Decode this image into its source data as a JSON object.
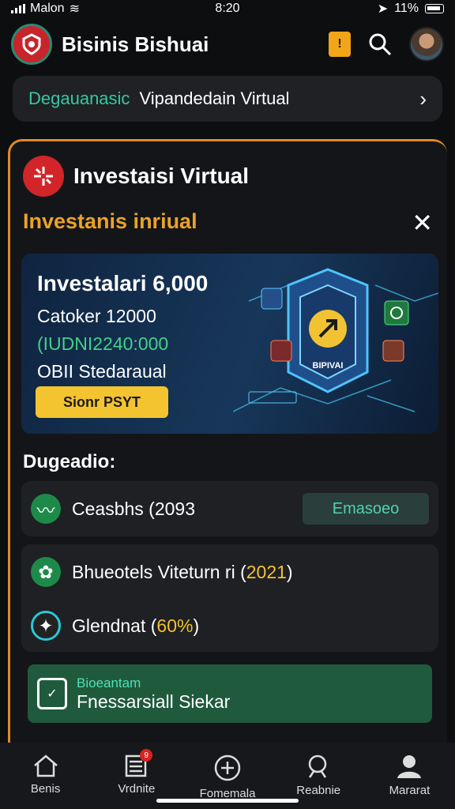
{
  "status": {
    "carrier": "Malon",
    "time": "8:20",
    "battery": "11%"
  },
  "header": {
    "title": "Bisinis Bishuai",
    "notif_glyph": "!"
  },
  "banner": {
    "tag": "Degauanasic",
    "text": "Vipandedain Virtual"
  },
  "card": {
    "title": "Investaisi Virtual",
    "subhead": "Investanis inriual",
    "hero": {
      "line1": "Investalari 6,000",
      "line2": "Catoker 12000",
      "line3": "(IUDNI2240:000",
      "line4": "OBII Stedaraual",
      "button": "Sionr PSYT",
      "art_label": "BIPIVAI"
    },
    "section_label": "Dugeadio:",
    "rows": [
      {
        "text": "Ceasbhs (2093",
        "pill": "Emasoeo"
      },
      {
        "text": "Bhueotels  Viteturn ri (",
        "highlight": "2021",
        "suffix": ")"
      },
      {
        "text": "Glendnat (",
        "highlight": "60%",
        "suffix": ")"
      }
    ],
    "green_card": {
      "sub": "Bioeantam",
      "title": "Fnessarsiall Siekar"
    }
  },
  "tabs": [
    {
      "label": "Benis",
      "icon": "home-icon"
    },
    {
      "label": "Vrdnite",
      "icon": "list-icon",
      "badge": "9"
    },
    {
      "label": "Fomemala",
      "icon": "plus-circle-icon"
    },
    {
      "label": "Reabnie",
      "icon": "search-icon"
    },
    {
      "label": "Mararat",
      "icon": "person-icon"
    }
  ],
  "colors": {
    "accent": "#e9a329",
    "teal": "#35c9a3",
    "green": "#1f5a3c",
    "yellow": "#f4c430"
  }
}
